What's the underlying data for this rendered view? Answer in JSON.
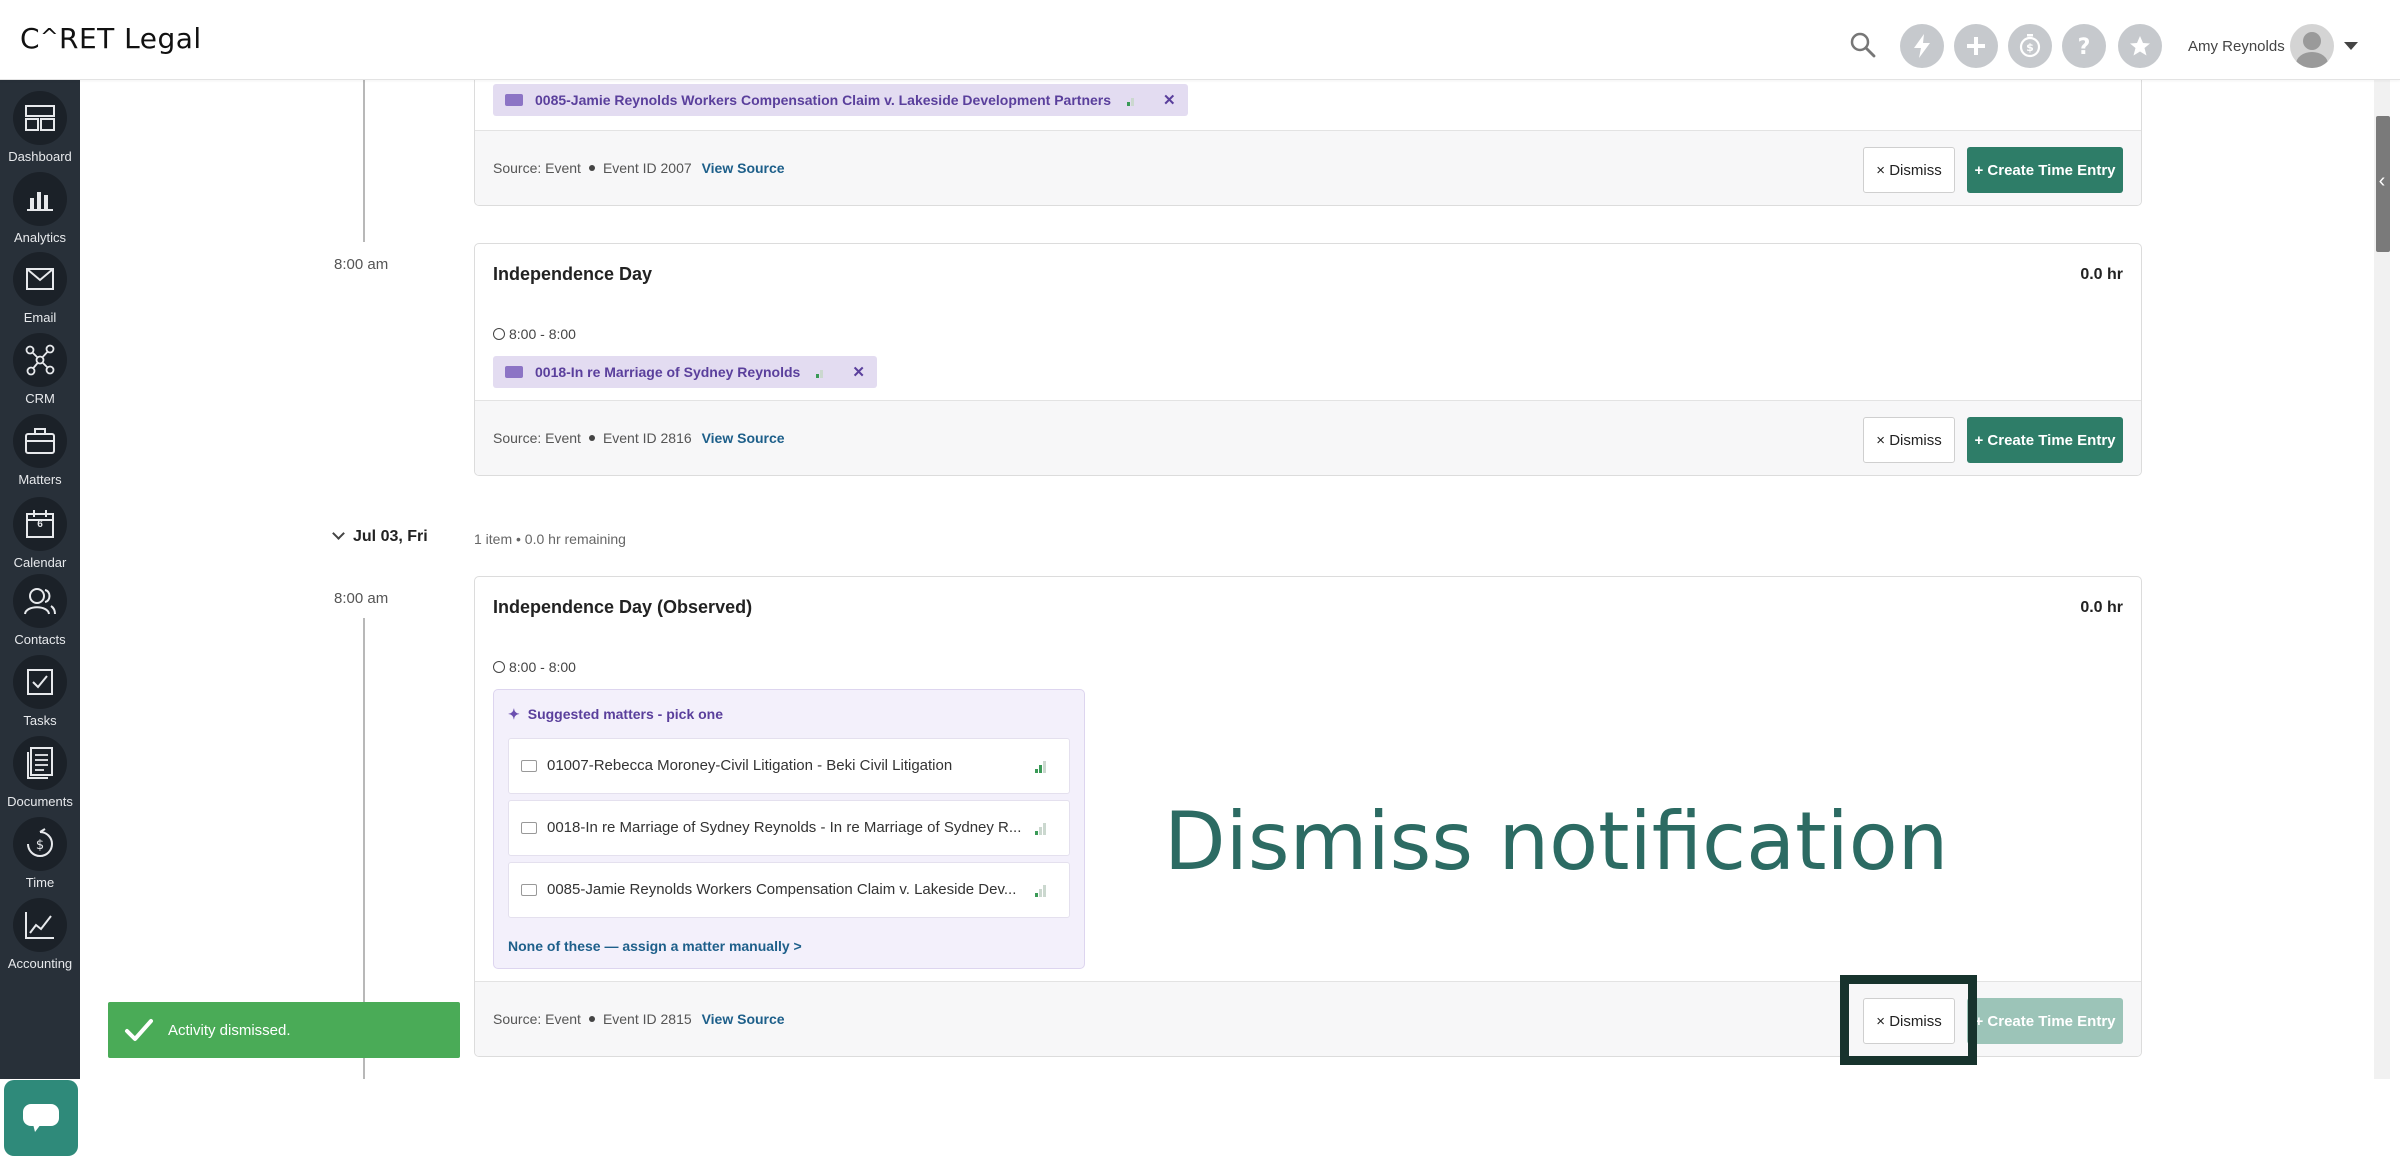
{
  "app": {
    "logo_text": "C^RET Legal"
  },
  "header": {
    "user_name": "Amy Reynolds",
    "buttons": [
      "lightning-icon",
      "plus-icon",
      "timer-icon",
      "help-icon",
      "star-icon"
    ]
  },
  "sidebar": {
    "items": [
      {
        "label": "Dashboard",
        "icon": "dashboard-icon"
      },
      {
        "label": "Analytics",
        "icon": "analytics-icon"
      },
      {
        "label": "Email",
        "icon": "email-icon"
      },
      {
        "label": "CRM",
        "icon": "crm-icon"
      },
      {
        "label": "Matters",
        "icon": "briefcase-icon"
      },
      {
        "label": "Calendar",
        "icon": "calendar-icon"
      },
      {
        "label": "Contacts",
        "icon": "contacts-icon"
      },
      {
        "label": "Tasks",
        "icon": "tasks-icon"
      },
      {
        "label": "Documents",
        "icon": "documents-icon"
      },
      {
        "label": "Time",
        "icon": "time-icon"
      },
      {
        "label": "Accounting",
        "icon": "accounting-icon"
      }
    ],
    "calendar_day": "6"
  },
  "cards": [
    {
      "matter": "0085-Jamie Reynolds Workers Compensation Claim v. Lakeside Development Partners",
      "source": "Source: Event",
      "event_id": "Event ID 2007",
      "view_source": "View Source",
      "dismiss": "× Dismiss",
      "create": "+ Create Time Entry"
    },
    {
      "time_label": "8:00 am",
      "title": "Independence Day",
      "hours": "0.0 hr",
      "time_range": "8:00 - 8:00",
      "matter": "0018-In re Marriage of Sydney Reynolds",
      "source": "Source: Event",
      "event_id": "Event ID 2816",
      "view_source": "View Source",
      "dismiss": "× Dismiss",
      "create": "+ Create Time Entry"
    },
    {
      "time_label": "8:00 am",
      "title": "Independence Day (Observed)",
      "hours": "0.0 hr",
      "time_range": "8:00 - 8:00",
      "source": "Source: Event",
      "event_id": "Event ID 2815",
      "view_source": "View Source",
      "dismiss": "× Dismiss",
      "create": "+ Create Time Entry"
    }
  ],
  "day_group": {
    "date": "Jul 03, Fri",
    "meta": "1 item • 0.0 hr remaining"
  },
  "suggested": {
    "title": "Suggested matters - pick one",
    "items": [
      "01007-Rebecca Moroney-Civil Litigation - Beki Civil Litigation",
      "0018-In re Marriage of Sydney Reynolds - In re Marriage of Sydney R...",
      "0085-Jamie Reynolds Workers Compensation Claim v. Lakeside Dev..."
    ],
    "manual": "None of these — assign a matter manually >"
  },
  "overlay": {
    "text": "Dismiss notification"
  },
  "toast": {
    "text": "Activity dismissed."
  },
  "colors": {
    "brand_green": "#2e7d68",
    "sidebar_bg": "#283039",
    "chip_purple": "#e3dcf1",
    "toast_green": "#4aab57"
  }
}
